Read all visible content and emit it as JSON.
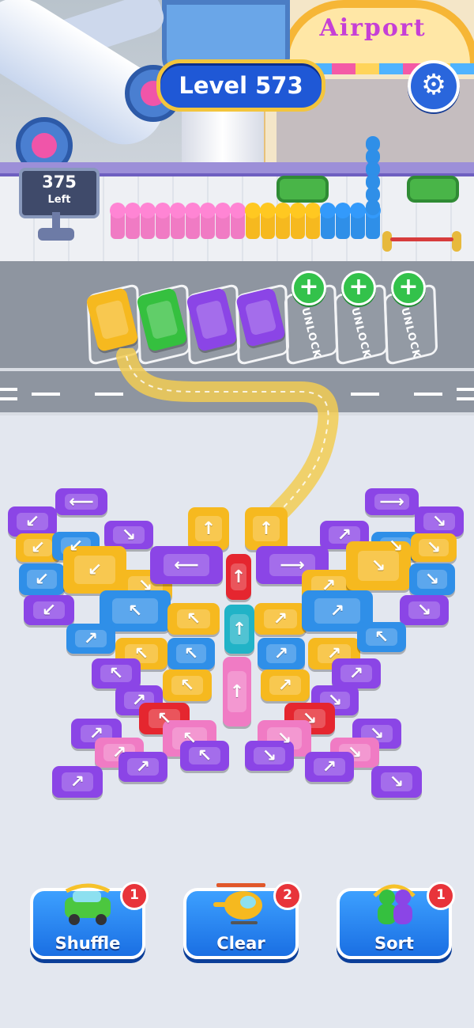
{
  "level": {
    "label": "Level 573"
  },
  "counter": {
    "value": "375",
    "label": "Left"
  },
  "building_sign": "Airport",
  "parking_slots": {
    "unlock_label": "UNLOCK",
    "unlock_plus": "+"
  },
  "boosters": [
    {
      "label": "Shuffle",
      "count": "1"
    },
    {
      "label": "Clear",
      "count": "2"
    },
    {
      "label": "Sort",
      "count": "1"
    }
  ],
  "icons": {
    "settings": "gear-icon"
  },
  "colors": {
    "purple": "#8b45e6",
    "yellow": "#f6b91f",
    "blue": "#2f8fe8",
    "red": "#e5262f",
    "pink": "#f07bc4",
    "teal": "#21b3c7",
    "green": "#35c03f"
  },
  "queue_colors": [
    "pink",
    "pink",
    "pink",
    "pink",
    "pink",
    "pink",
    "pink",
    "pink",
    "pink",
    "yellow",
    "yellow",
    "yellow",
    "yellow",
    "yellow",
    "blue",
    "blue",
    "blue",
    "blue"
  ]
}
